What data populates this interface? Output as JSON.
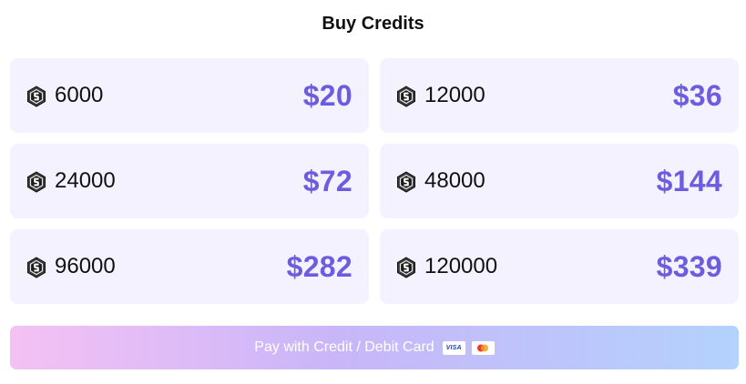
{
  "page": {
    "title": "Buy Credits"
  },
  "colors": {
    "card_background": "#f3f2fe",
    "price_accent": "#6c5ce0",
    "button_gradient_start": "#f5c1f4",
    "button_gradient_mid": "#c8b6f9",
    "button_gradient_end": "#b3d2fd",
    "visa_text": "#1a3fb8",
    "mc_red": "#eb3b30",
    "mc_orange": "#f79e1b"
  },
  "icons": {
    "credit": "hexagon-coin-icon",
    "visa": "visa-card-icon",
    "mastercard": "mastercard-icon"
  },
  "packages": [
    {
      "credits": "6000",
      "price": "$20"
    },
    {
      "credits": "12000",
      "price": "$36"
    },
    {
      "credits": "24000",
      "price": "$72"
    },
    {
      "credits": "48000",
      "price": "$144"
    },
    {
      "credits": "96000",
      "price": "$282"
    },
    {
      "credits": "120000",
      "price": "$339"
    }
  ],
  "payment": {
    "button_label": "Pay with Credit / Debit Card",
    "visa_label": "VISA"
  }
}
